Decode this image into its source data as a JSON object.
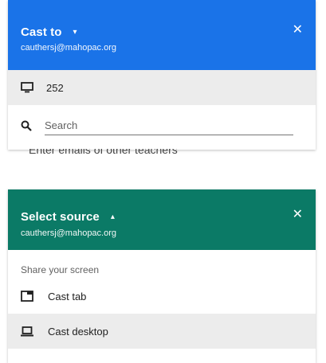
{
  "cast_dialog": {
    "title": "Cast to",
    "dropdown_arrow": "▾",
    "account": "cauthersj@mahopac.org",
    "close": "✕",
    "device": {
      "icon": "tv-icon",
      "label": "252"
    },
    "search": {
      "icon": "search-icon",
      "placeholder": "Search"
    }
  },
  "background_text": "Enter emails of other teachers",
  "source_dialog": {
    "title": "Select source",
    "dropdown_arrow": "▴",
    "account": "cauthersj@mahopac.org",
    "close": "✕",
    "section_label": "Share your screen",
    "items": [
      {
        "icon": "tab-icon",
        "label": "Cast tab",
        "selected": false
      },
      {
        "icon": "laptop-icon",
        "label": "Cast desktop",
        "selected": true
      }
    ]
  },
  "colors": {
    "cast_header": "#1a73e8",
    "source_header": "#0b7a66",
    "selected_row": "#ececec"
  }
}
